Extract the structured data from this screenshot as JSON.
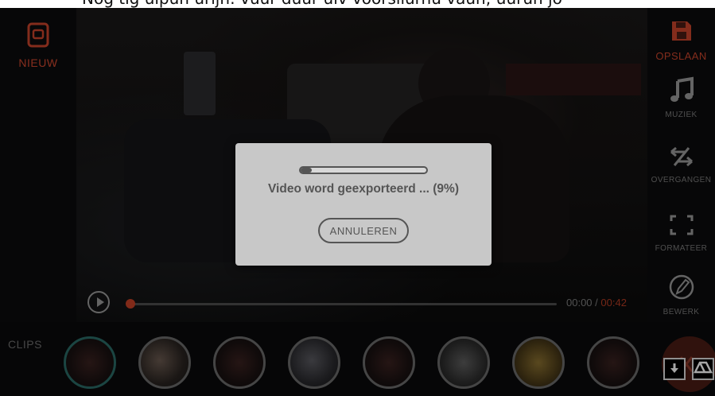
{
  "top_banner": {
    "text": "Nog tig ulpun urijn: vuur duur ulv voorsliurnu vaun; uuruh jo"
  },
  "left_sidebar": {
    "new": {
      "label": "NIEUW",
      "icon": "document-icon"
    }
  },
  "player": {
    "current_time": "00:00",
    "separator": " / ",
    "duration": "00:42",
    "progress_fraction": 0.0,
    "play_icon": "play-icon"
  },
  "right_sidebar": {
    "items": [
      {
        "label": "OPSLAAN",
        "icon": "save-icon"
      },
      {
        "label": "MUZIEK",
        "icon": "music-note-icon"
      },
      {
        "label": "OVERGANGEN",
        "icon": "transition-icon"
      },
      {
        "label": "FORMATEER",
        "icon": "crop-frame-icon"
      },
      {
        "label": "BEWERK",
        "icon": "pencil-icon"
      }
    ]
  },
  "clips": {
    "label": "CLIPS",
    "count": 8,
    "selected_index": 0
  },
  "corner_buttons": [
    "download-icon",
    "google-drive-icon"
  ],
  "export_dialog": {
    "message": "Video word geexporteerd ... (9%)",
    "progress": 0.09,
    "cancel_label": "ANNULEREN"
  },
  "colors": {
    "accent": "#c9442b",
    "selected_clip_ring": "#2a6b66",
    "dialog_bg": "#c8c8c8"
  }
}
